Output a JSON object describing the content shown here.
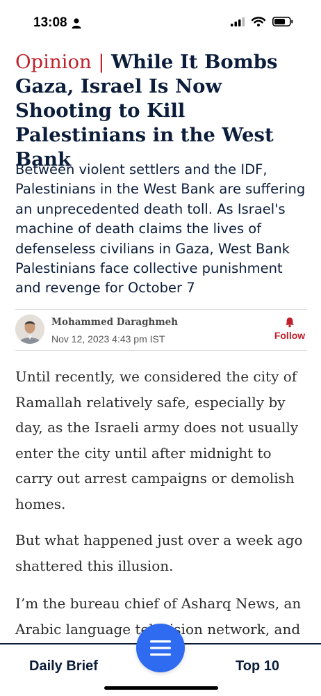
{
  "status_bar": {
    "time": "13:08"
  },
  "article": {
    "section_label": "Opinion",
    "separator": "|",
    "title": "While It Bombs Gaza, Israel Is Now Shooting to Kill Palestinians in the West Bank",
    "subtitle": "Between violent settlers and the IDF, Palestinians in the West Bank are suffering an unprecedented death toll. As Israel's machine of death claims the lives of defenseless civilians in Gaza, West Bank Palestinians face collective punishment and revenge for October 7",
    "author": {
      "name": "Mohammed Daraghmeh",
      "date": "Nov 12, 2023 4:43 pm IST",
      "follow_label": "Follow"
    },
    "paragraphs": [
      "Until recently, we considered the city of Ramallah relatively safe, especially by day, as the Israeli army does not usually enter the city until after midnight to carry out arrest campaigns or demolish homes.",
      "But what happened just over a week ago shattered this illusion.",
      "I’m the bureau chief of Asharq News, an Arabic language television network, and"
    ]
  },
  "bottom_nav": {
    "left_label": "Daily Brief",
    "right_label": "Top 10",
    "menu_icon": "hamburger-menu-icon"
  },
  "colors": {
    "accent_red": "#c0202a",
    "navy": "#0b1d3a",
    "fab_blue": "#2f6bf0"
  }
}
